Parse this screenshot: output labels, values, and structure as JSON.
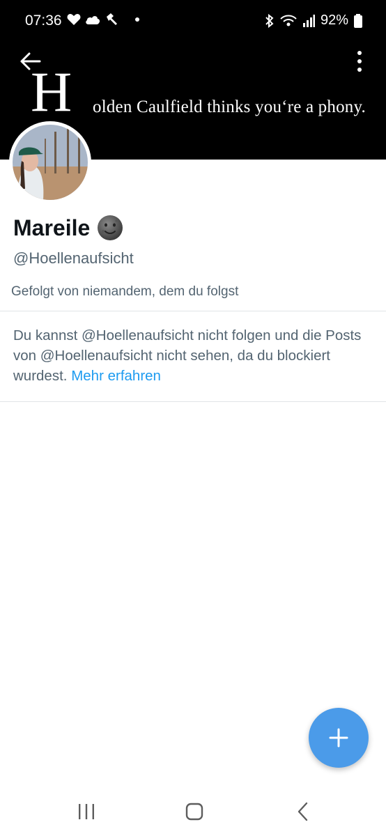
{
  "status_bar": {
    "time": "07:36",
    "battery": "92%",
    "icons_left": [
      "heart-icon",
      "cloud-icon",
      "hammer-icon",
      "dot-icon"
    ],
    "icons_right": [
      "bluetooth-icon",
      "wifi-icon",
      "signal-icon",
      "battery-icon"
    ]
  },
  "header": {
    "banner_initial": "H",
    "banner_text": "olden Caulfield thinks you‘re a phony."
  },
  "profile": {
    "display_name": "Mareile",
    "handle": "@Hoellenaufsicht",
    "followed_by": "Gefolgt von niemandem, dem du folgst"
  },
  "blocked_notice": {
    "text": "Du kannst @Hoellenaufsicht nicht folgen und die Posts von @Hoellenaufsicht nicht sehen, da du blockiert wurdest.",
    "link_label": "Mehr erfahren"
  },
  "colors": {
    "accent": "#1d9bf0",
    "fab": "#4b9be9",
    "secondary_text": "#536471"
  }
}
